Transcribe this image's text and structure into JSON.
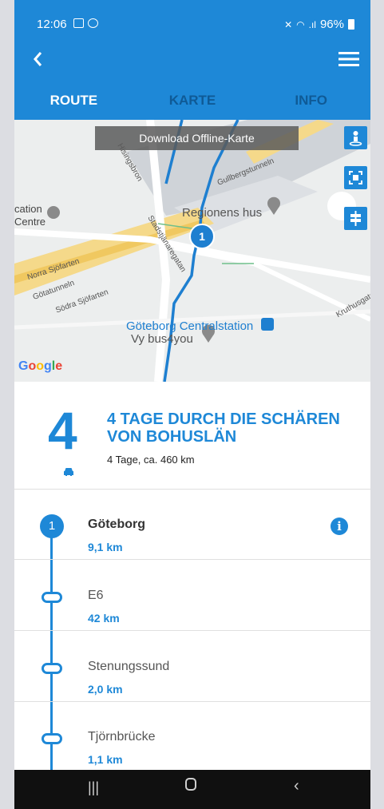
{
  "status_bar": {
    "time": "12:06",
    "battery": "96%"
  },
  "tabs": [
    {
      "label": "ROUTE",
      "active": true
    },
    {
      "label": "KARTE",
      "active": false
    },
    {
      "label": "INFO",
      "active": false
    }
  ],
  "map": {
    "download_label": "Download Offline-Karte",
    "labels": {
      "station_a": "cation",
      "station_b": "Centre",
      "regionens": "Regionens hus",
      "norra": "Norra Sjöfarten",
      "gota": "Götatunneln",
      "sodra": "Södra Sjöfarten",
      "gullberg": "Gullbergstunneln",
      "hisings": "Hisingsbron",
      "stads": "Stadstjänaregatan",
      "centralstation": "Göteborg Centralstation",
      "vybus": "Vy bus4you",
      "kruthus": "Kruthusgatan",
      "google": "Google"
    },
    "marker_number": "1"
  },
  "trip": {
    "number": "4",
    "title": "4 TAGE DURCH DIE SCHÄREN VON BOHUSLÄN",
    "subtitle": "4 Tage, ca. 460 km"
  },
  "stops": [
    {
      "number": "1",
      "name": "Göteborg",
      "distance": "9,1 km"
    },
    {
      "name": "E6",
      "distance": "42 km"
    },
    {
      "name": "Stenungssund",
      "distance": "2,0 km"
    },
    {
      "name": "Tjörnbrücke",
      "distance": "1,1 km"
    }
  ],
  "colors": {
    "primary": "#1e88d7",
    "tab_inactive": "#0f5a96"
  }
}
